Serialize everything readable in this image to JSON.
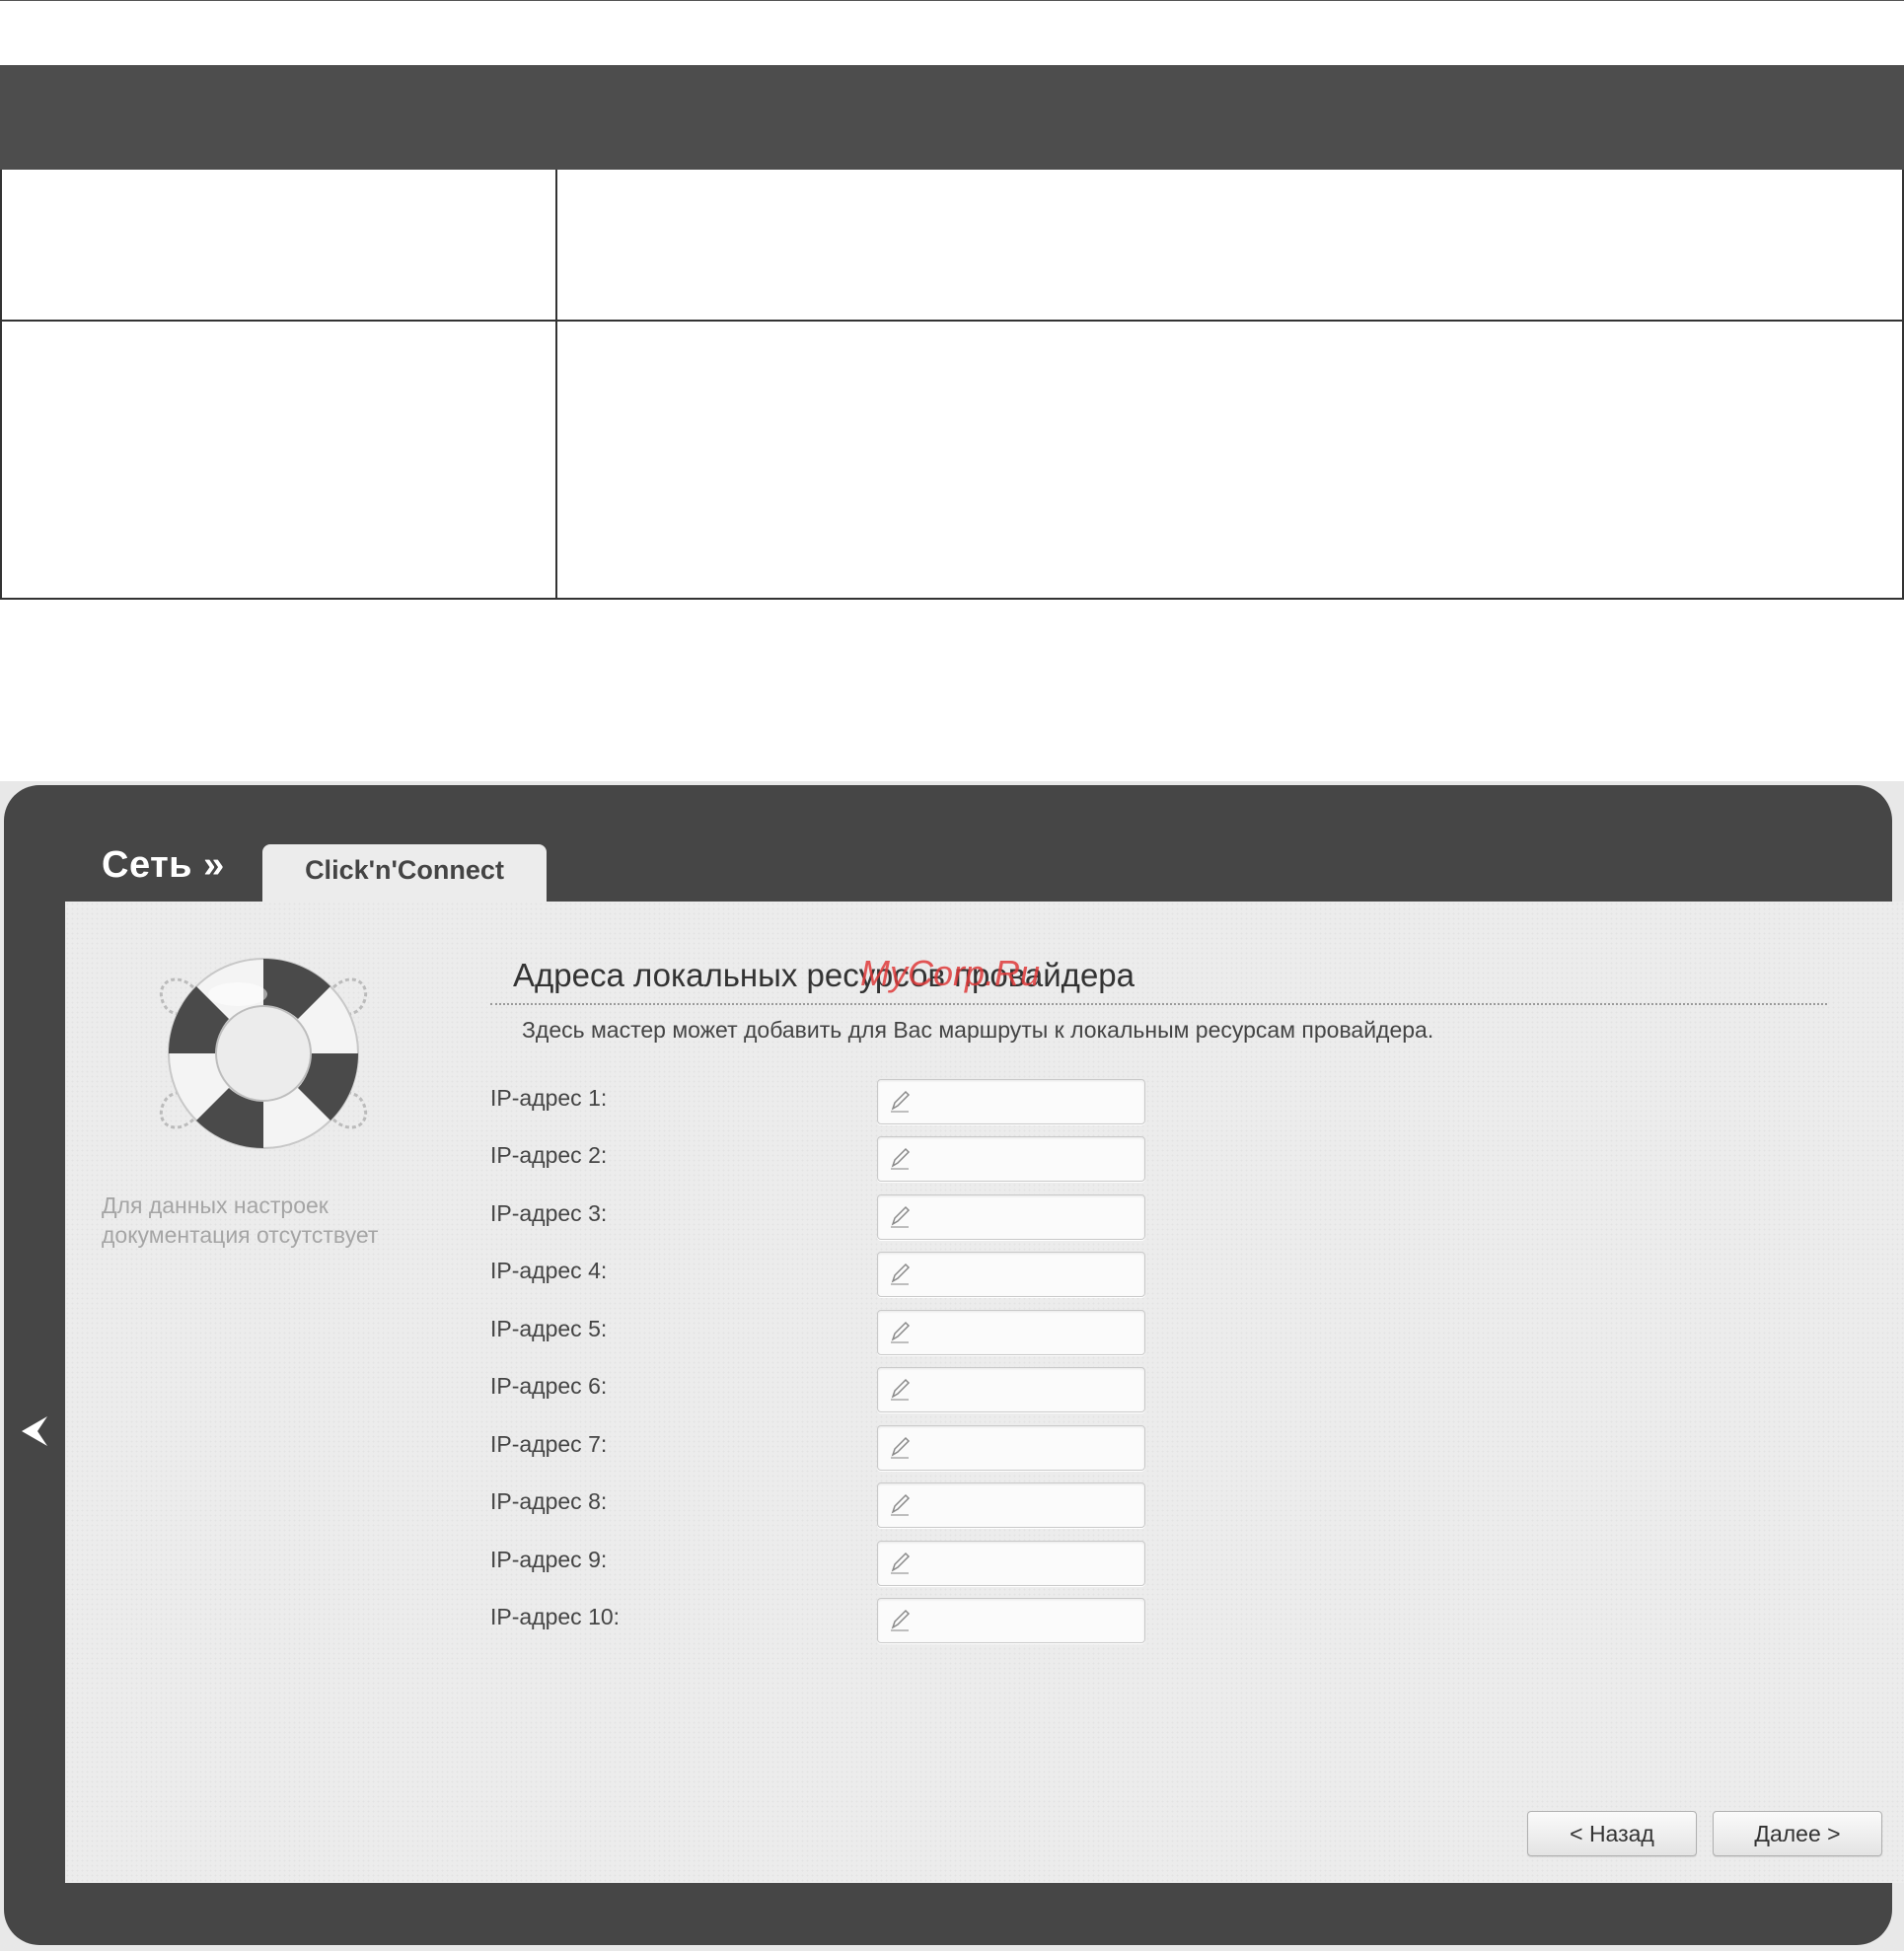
{
  "breadcrumb": {
    "section": "Сеть »",
    "tab": "Click'n'Connect"
  },
  "help": {
    "text": "Для данных настроек документация отсутствует"
  },
  "watermark": "MyCorp.Ru",
  "main": {
    "title": "Адреса локальных ресурсов провайдера",
    "intro": "Здесь мастер может добавить для Вас маршруты к локальным ресурсам провайдера.",
    "fields": [
      {
        "label": "IP-адрес 1:",
        "value": ""
      },
      {
        "label": "IP-адрес 2:",
        "value": ""
      },
      {
        "label": "IP-адрес 3:",
        "value": ""
      },
      {
        "label": "IP-адрес 4:",
        "value": ""
      },
      {
        "label": "IP-адрес 5:",
        "value": ""
      },
      {
        "label": "IP-адрес 6:",
        "value": ""
      },
      {
        "label": "IP-адрес 7:",
        "value": ""
      },
      {
        "label": "IP-адрес 8:",
        "value": ""
      },
      {
        "label": "IP-адрес 9:",
        "value": ""
      },
      {
        "label": "IP-адрес 10:",
        "value": ""
      }
    ]
  },
  "buttons": {
    "back": "< Назад",
    "next": "Далее >"
  },
  "icons": {
    "nav": "chevron-left-icon",
    "field": "pencil-icon",
    "help": "lifebuoy-icon"
  },
  "colors": {
    "frame": "#464646",
    "panel": "#ececec",
    "table_header": "#4d4d4d",
    "watermark": "#e03a3a"
  }
}
